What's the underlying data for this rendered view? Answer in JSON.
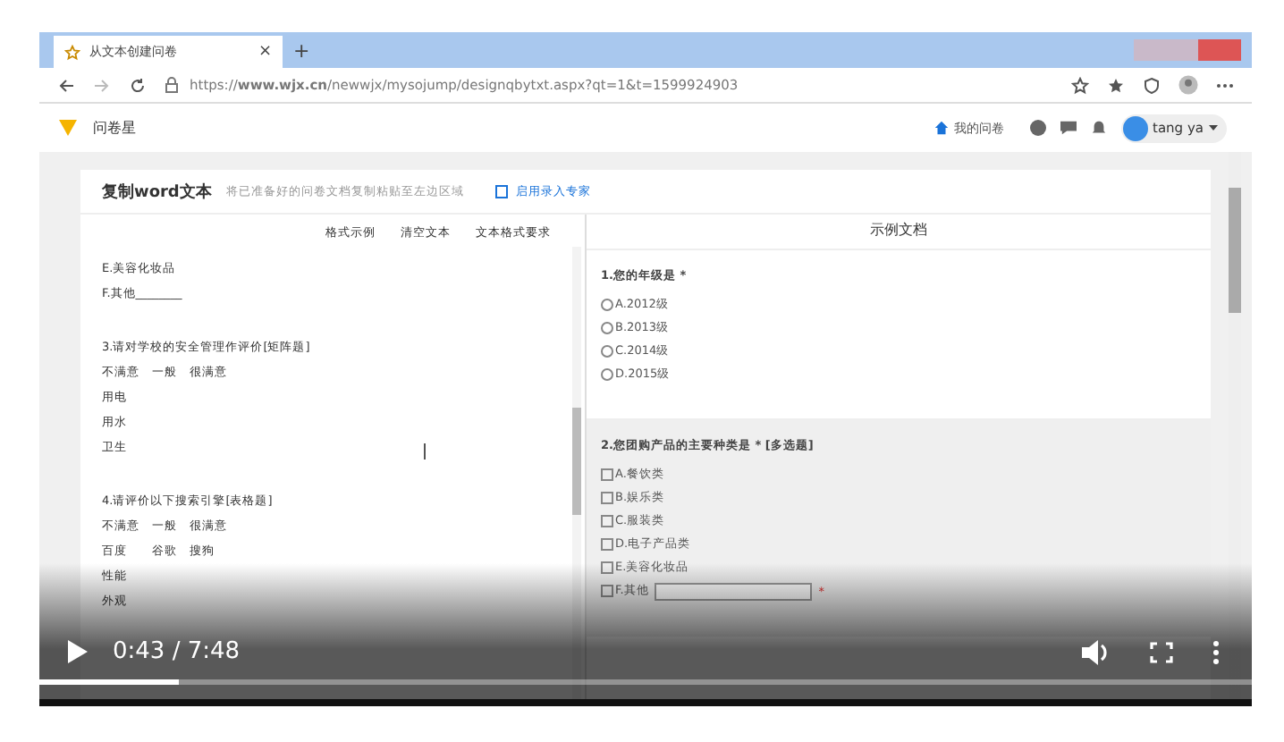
{
  "browser": {
    "tab_title": "从文本创建问卷",
    "tab_close": "×",
    "new_tab": "+",
    "url": "https://**www.wjx.cn**/newwjx/mysojump/designqbytxt.aspx?qt=1&t=1599924903"
  },
  "site_header": {
    "brand": "问卷星",
    "my_surveys": "我的问卷",
    "user": "tang ya"
  },
  "editor": {
    "title": "复制word文本",
    "hint": "将已准备好的问卷文档复制粘贴至左边区域",
    "expert_link": "启用录入专家",
    "toolbar": [
      "格式示例",
      "清空文本",
      "文本格式要求"
    ],
    "text_paragraphs": [
      [
        "E.美容化妆品",
        "F.其他________"
      ],
      [
        "3.请对学校的安全管理作评价[矩阵题]",
        "不满意　一般　很满意",
        "用电",
        "用水",
        "卫生"
      ],
      [
        "4.请评价以下搜索引擎[表格题]",
        "不满意　一般　很满意",
        "百度　　谷歌　搜狗",
        "性能",
        "外观"
      ]
    ]
  },
  "preview": {
    "title": "示例文档",
    "questions": [
      {
        "title": "1.您的年级是 *",
        "highlighted": false,
        "kind": "radio",
        "options": [
          {
            "label": "A.2012级"
          },
          {
            "label": "B.2013级"
          },
          {
            "label": "C.2014级"
          },
          {
            "label": "D.2015级"
          }
        ]
      },
      {
        "title": "2.您团购产品的主要种类是 * [多选题]",
        "highlighted": true,
        "kind": "checkbox",
        "options": [
          {
            "label": "A.餐饮类"
          },
          {
            "label": "B.娱乐类"
          },
          {
            "label": "C.服装类"
          },
          {
            "label": "D.电子产品类"
          },
          {
            "label": "E.美容化妆品"
          },
          {
            "label": "F.其他",
            "input": true,
            "required_mark": "*"
          }
        ]
      }
    ]
  },
  "player": {
    "time": "0:43 / 7:48",
    "progress": {
      "level": 0.115
    }
  }
}
